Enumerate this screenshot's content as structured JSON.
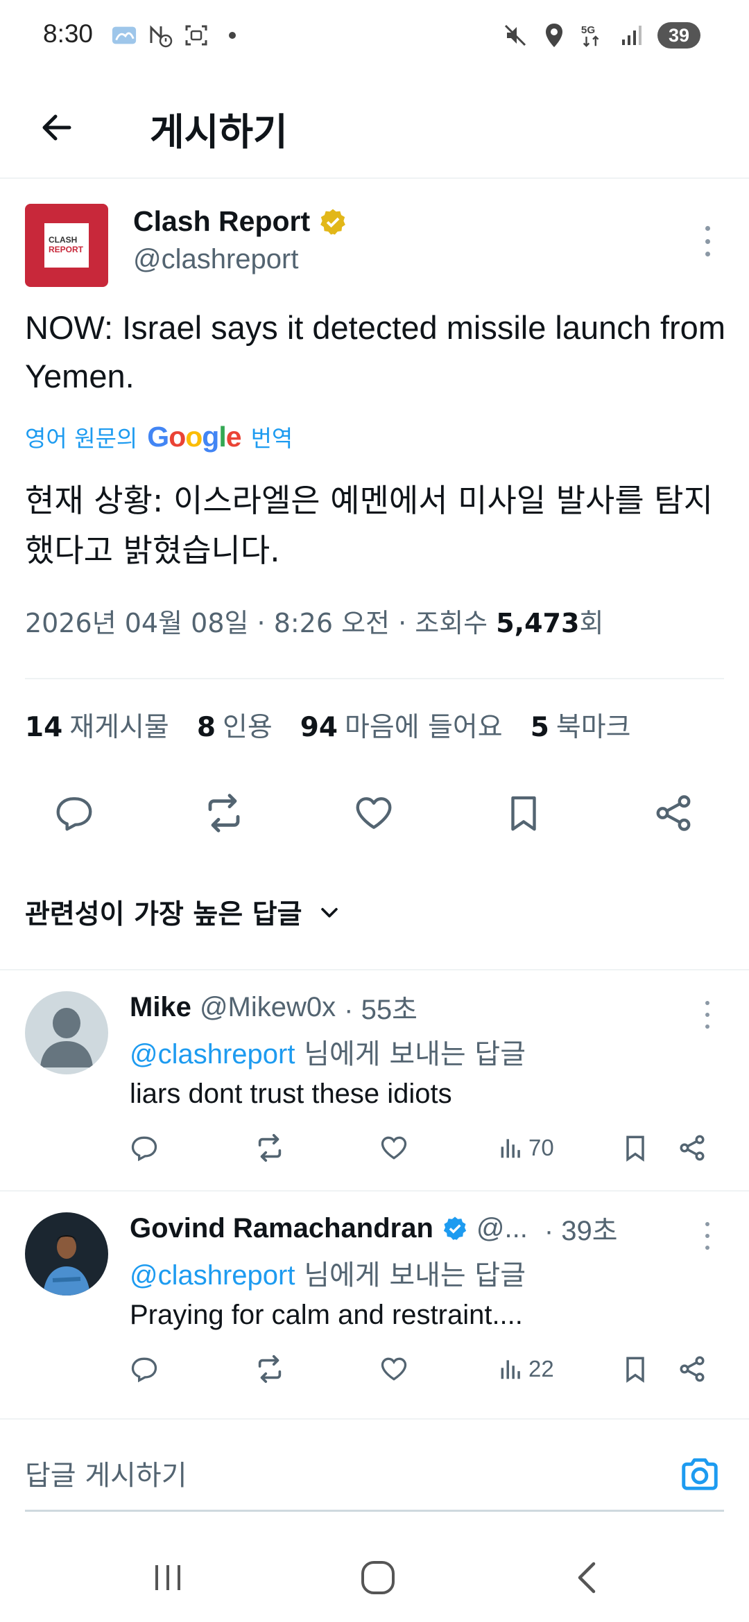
{
  "status_bar": {
    "time": "8:30",
    "battery": "39",
    "network": "5G"
  },
  "header": {
    "title": "게시하기"
  },
  "tweet": {
    "author_name": "Clash Report",
    "author_handle": "@clashreport",
    "avatar_line1": "CLASH",
    "avatar_line2": "REPORT",
    "text": "NOW: Israel says it detected missile launch from Yemen.",
    "translate_prefix": "영어 원문의",
    "translate_brand": "Google",
    "translate_suffix": "번역",
    "translated_text": "현재 상황: 이스라엘은 예멘에서 미사일 발사를 탐지했다고 밝혔습니다.",
    "meta_prefix": "2026년 04월 08일 · 8:26 오전 · 조회수 ",
    "views": "5,473",
    "views_unit": "회",
    "stats": [
      {
        "count": "14",
        "label": "재게시물"
      },
      {
        "count": "8",
        "label": "인용"
      },
      {
        "count": "94",
        "label": "마음에 들어요"
      },
      {
        "count": "5",
        "label": "북마크"
      }
    ]
  },
  "sort": {
    "label": "관련성이 가장 높은 답글"
  },
  "replies": [
    {
      "name": "Mike",
      "handle": "@Mikew0x",
      "time": "· 55초",
      "reply_to_mention": "@clashreport",
      "reply_to_suffix": " 님에게 보내는 답글",
      "text": "liars dont trust these idiots",
      "views": "70"
    },
    {
      "name": "Govind Ramachandran",
      "handle": "@...",
      "time": "· 39초",
      "reply_to_mention": "@clashreport",
      "reply_to_suffix": " 님에게 보내는 답글",
      "text": "Praying for calm and restraint....",
      "views": "22"
    }
  ],
  "compose": {
    "placeholder": "답글 게시하기"
  },
  "colors": {
    "accent": "#1d9bf0",
    "brand_red": "#c8283a",
    "verified_gold": "#e2b719",
    "secondary_text": "#536471"
  }
}
